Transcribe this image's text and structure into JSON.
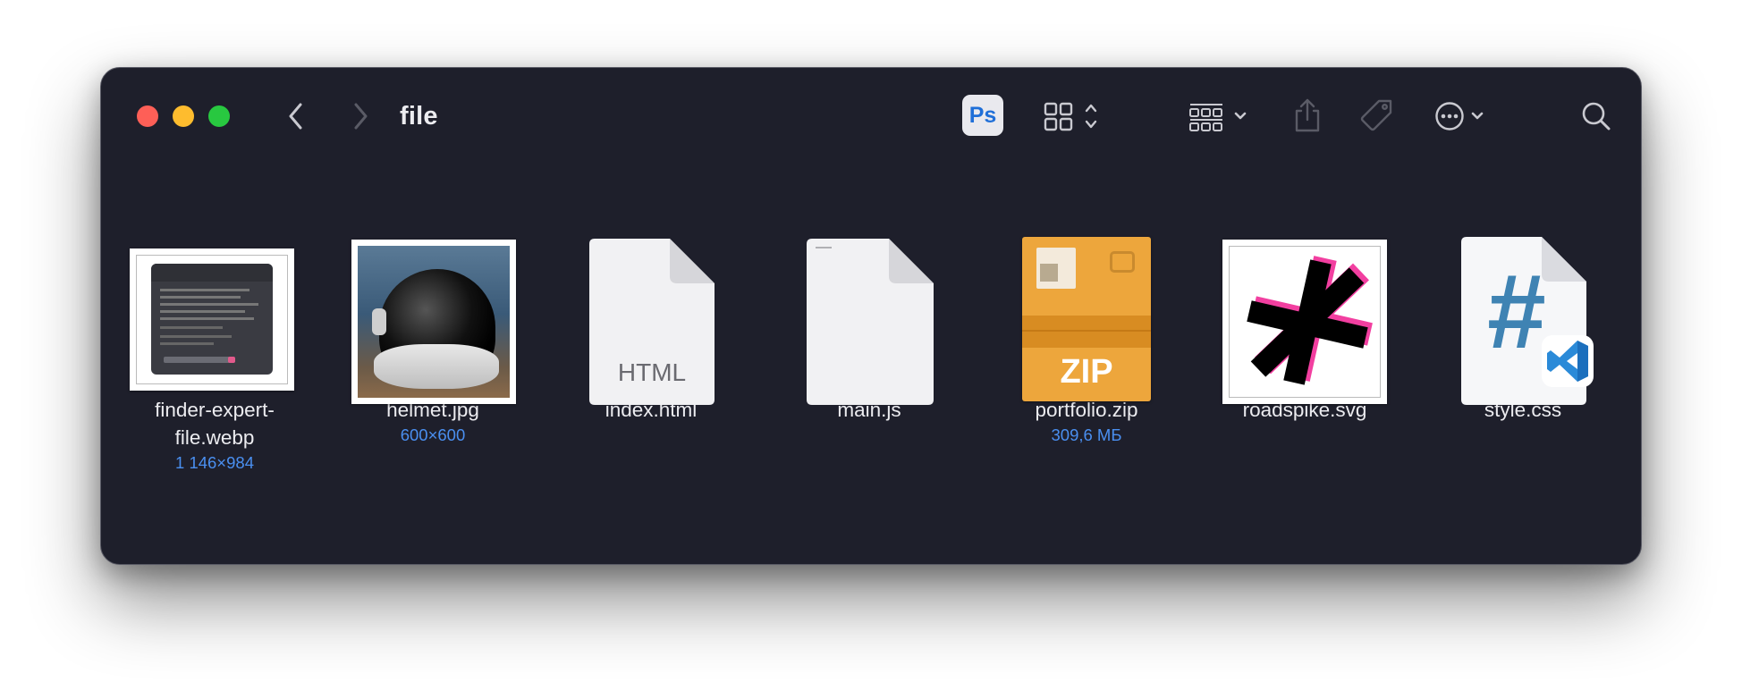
{
  "window": {
    "title": "file"
  },
  "toolbar": {
    "back_icon": "chevron-left-icon",
    "forward_icon": "chevron-right-icon",
    "ps_label": "Ps",
    "view_icon": "grid-view-icon",
    "group_icon": "group-by-icon",
    "share_icon": "share-icon",
    "tag_icon": "tag-icon",
    "more_icon": "ellipsis-circle-icon",
    "search_icon": "search-icon"
  },
  "files": [
    {
      "name": "finder-expert-file.webp",
      "meta": "1 146×984"
    },
    {
      "name": "helmet.jpg",
      "meta": "600×600"
    },
    {
      "name": "index.html",
      "meta": "",
      "badge": "HTML"
    },
    {
      "name": "main.js",
      "meta": ""
    },
    {
      "name": "portfolio.zip",
      "meta": "309,6 МБ",
      "badge": "ZIP"
    },
    {
      "name": "roadspike.svg",
      "meta": ""
    },
    {
      "name": "style.css",
      "meta": "",
      "badge": "#"
    }
  ],
  "colors": {
    "window_bg": "#1e1f2b",
    "meta_text": "#4a8ff0",
    "zip_orange": "#eda63c",
    "css_hash": "#3f83b3",
    "svg_pink": "#f23fa0"
  }
}
